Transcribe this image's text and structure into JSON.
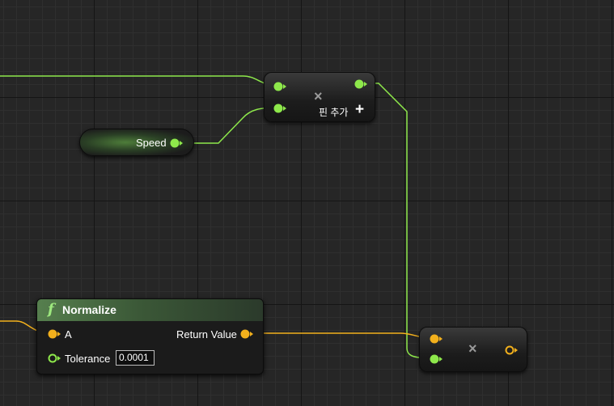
{
  "colors": {
    "float_pin": "#8ee84b",
    "vector_pin": "#f2b01c"
  },
  "add_node": {
    "add_pin_label": "핀 추가"
  },
  "speed_node": {
    "label": "Speed"
  },
  "normalize_node": {
    "title": "Normalize",
    "input_a_label": "A",
    "return_label": "Return Value",
    "tolerance_label": "Tolerance",
    "tolerance_value": "0.0001"
  },
  "icons": {
    "multiply": "×",
    "add_pin": "+",
    "function": "f"
  }
}
